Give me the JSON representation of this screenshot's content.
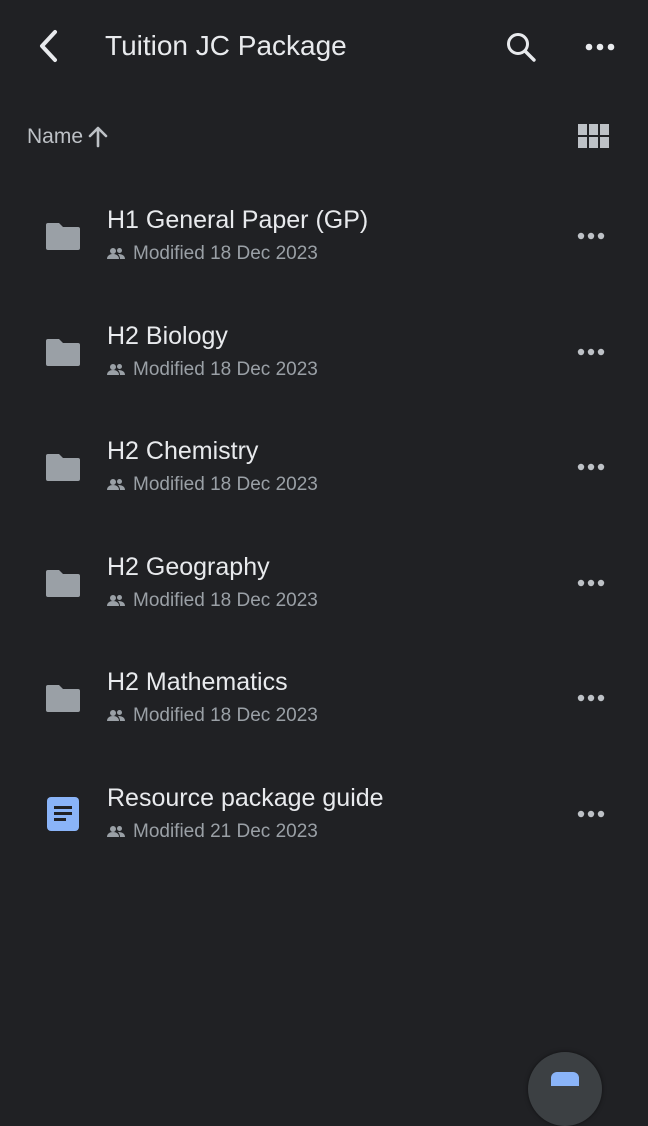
{
  "header": {
    "title": "Tuition JC Package",
    "back_icon": "back-arrow-icon",
    "search_icon": "search-icon",
    "more_icon": "more-horizontal-icon"
  },
  "sort": {
    "label": "Name",
    "direction_icon": "arrow-up-icon",
    "view_icon": "grid-view-icon"
  },
  "items": [
    {
      "name": "H1 General Paper (GP)",
      "type": "folder",
      "shared": true,
      "modified": "Modified 18 Dec 2023"
    },
    {
      "name": "H2 Biology",
      "type": "folder",
      "shared": true,
      "modified": "Modified 18 Dec 2023"
    },
    {
      "name": "H2 Chemistry",
      "type": "folder",
      "shared": true,
      "modified": "Modified 18 Dec 2023"
    },
    {
      "name": "H2 Geography",
      "type": "folder",
      "shared": true,
      "modified": "Modified 18 Dec 2023"
    },
    {
      "name": "H2 Mathematics",
      "type": "folder",
      "shared": true,
      "modified": "Modified 18 Dec 2023"
    },
    {
      "name": "Resource package guide",
      "type": "document",
      "shared": true,
      "modified": "Modified 21 Dec 2023"
    }
  ],
  "colors": {
    "background": "#202124",
    "primary_text": "#e8eaed",
    "secondary_text": "#9aa0a6",
    "folder_icon": "#9aa0a6",
    "doc_icon": "#8ab4f8"
  },
  "fab": {
    "icon": "new-icon"
  }
}
